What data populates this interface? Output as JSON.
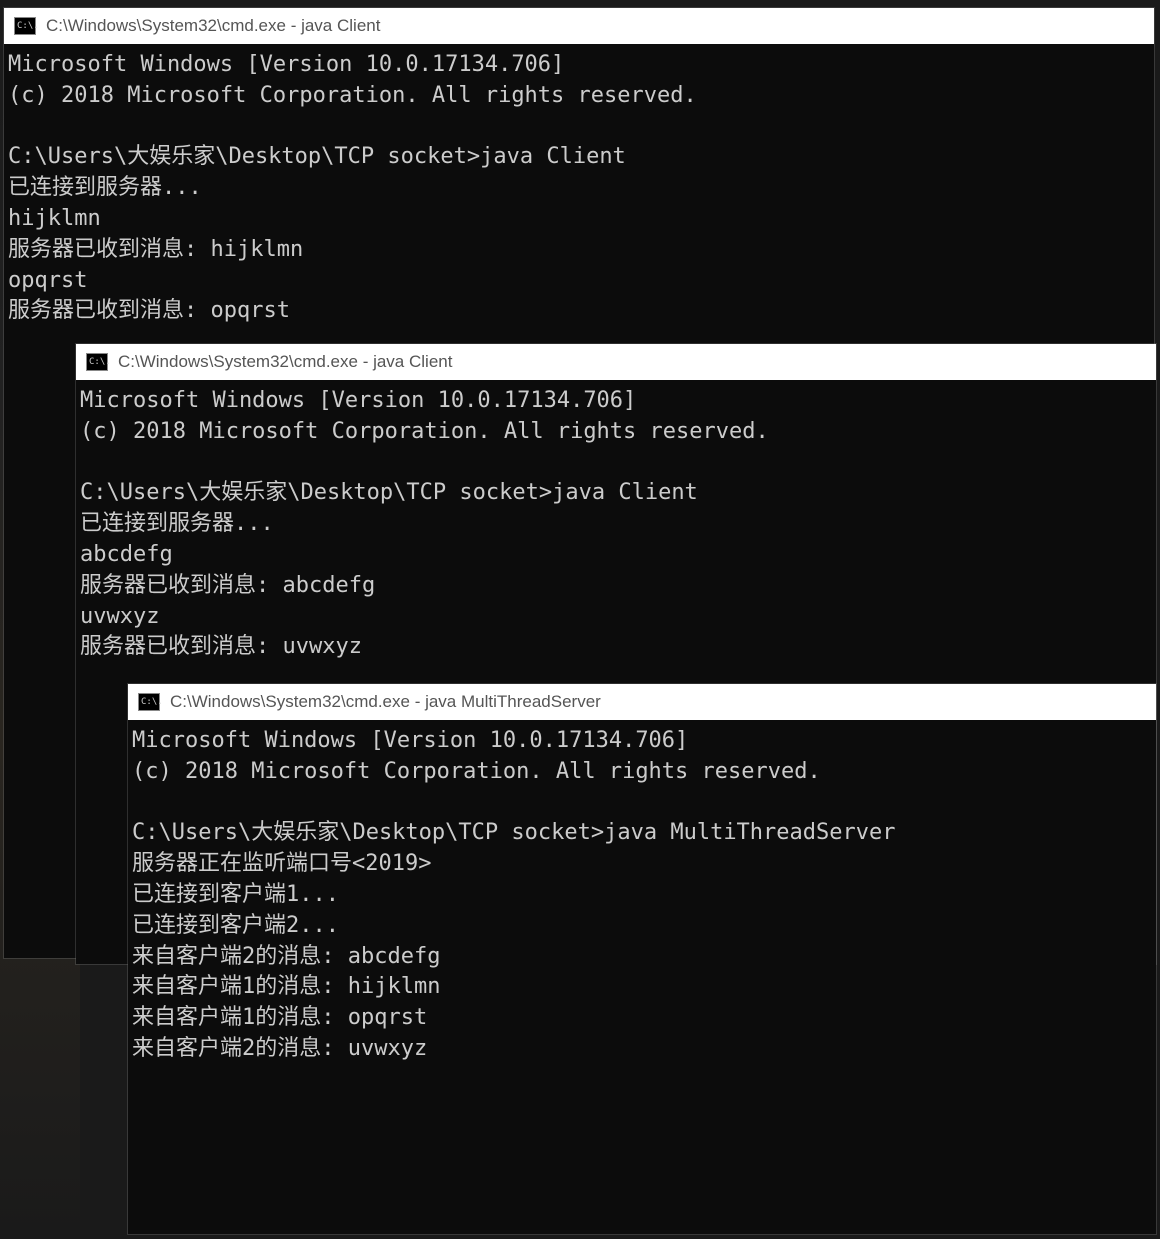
{
  "windows": [
    {
      "title": "C:\\Windows\\System32\\cmd.exe - java  Client",
      "icon_label": "C:\\.",
      "content": "Microsoft Windows [Version 10.0.17134.706]\n(c) 2018 Microsoft Corporation. All rights reserved.\n\nC:\\Users\\大娱乐家\\Desktop\\TCP socket>java Client\n已连接到服务器...\nhijklmn\n服务器已收到消息: hijklmn\nopqrst\n服务器已收到消息: opqrst"
    },
    {
      "title": "C:\\Windows\\System32\\cmd.exe - java  Client",
      "icon_label": "C:\\.",
      "content": "Microsoft Windows [Version 10.0.17134.706]\n(c) 2018 Microsoft Corporation. All rights reserved.\n\nC:\\Users\\大娱乐家\\Desktop\\TCP socket>java Client\n已连接到服务器...\nabcdefg\n服务器已收到消息: abcdefg\nuvwxyz\n服务器已收到消息: uvwxyz"
    },
    {
      "title": "C:\\Windows\\System32\\cmd.exe - java  MultiThreadServer",
      "icon_label": "C:\\.",
      "content": "Microsoft Windows [Version 10.0.17134.706]\n(c) 2018 Microsoft Corporation. All rights reserved.\n\nC:\\Users\\大娱乐家\\Desktop\\TCP socket>java MultiThreadServer\n服务器正在监听端口号<2019>\n已连接到客户端1...\n已连接到客户端2...\n来自客户端2的消息: abcdefg\n来自客户端1的消息: hijklmn\n来自客户端1的消息: opqrst\n来自客户端2的消息: uvwxyz"
    }
  ]
}
